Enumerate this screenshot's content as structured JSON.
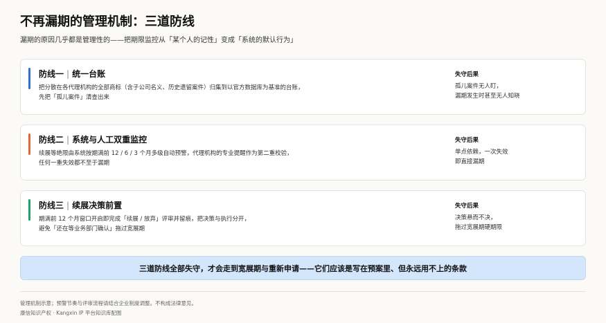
{
  "header": {
    "title": "不再漏期的管理机制：三道防线",
    "subtitle": "漏期的原因几乎都是管理性的——把期限监控从「某个人的记性」变成「系统的默认行为」"
  },
  "cards": [
    {
      "title_a": "防线一",
      "separator": "|",
      "title_b": "统一台账",
      "desc_line1": "把分散在各代理机构的全部商标（含子公司名义、历史遗留案件）归集到以官方数据库为基准的台账，",
      "desc_line2": "先把「孤儿案件」清查出来",
      "side_label": "失守后果",
      "side_line1": "孤儿案件无人盯，",
      "side_line2": "漏期发生时甚至无人知晓",
      "accent_color": "#2f6fd1"
    },
    {
      "title_a": "防线二",
      "separator": "|",
      "title_b": "系统与人工双重监控",
      "desc_line1": "续展等绝限由系统按期满前 12 / 6 / 3 个月多级自动预警，代理机构的专业提醒作为第二重校验，",
      "desc_line2": "任何一重失效都不至于漏期",
      "side_label": "失守后果",
      "side_line1": "单点依赖，一次失效",
      "side_line2": "即直接漏期",
      "accent_color": "#e2683a"
    },
    {
      "title_a": "防线三",
      "separator": "|",
      "title_b": "续展决策前置",
      "desc_line1": "期满前 12 个月窗口开启即完成「续展 / 放弃」评审并留痕，把决策与执行分开，",
      "desc_line2": "避免「还在等业务部门确认」拖过宽展期",
      "side_label": "失守后果",
      "side_line1": "决策悬而不决，",
      "side_line2": "拖过宽展期硬期限",
      "accent_color": "#22a06b"
    }
  ],
  "banner": {
    "text": "三道防线全部失守，才会走到宽展期与重新申请——它们应该是写在预案里、但永远用不上的条款"
  },
  "footer": {
    "line1": "管理机制示意；预警节奏与评审流程请结合企业制度调整。不构成法律意见。",
    "line2": "康信知识产权 · Kangxin IP 平台知识库配图"
  }
}
